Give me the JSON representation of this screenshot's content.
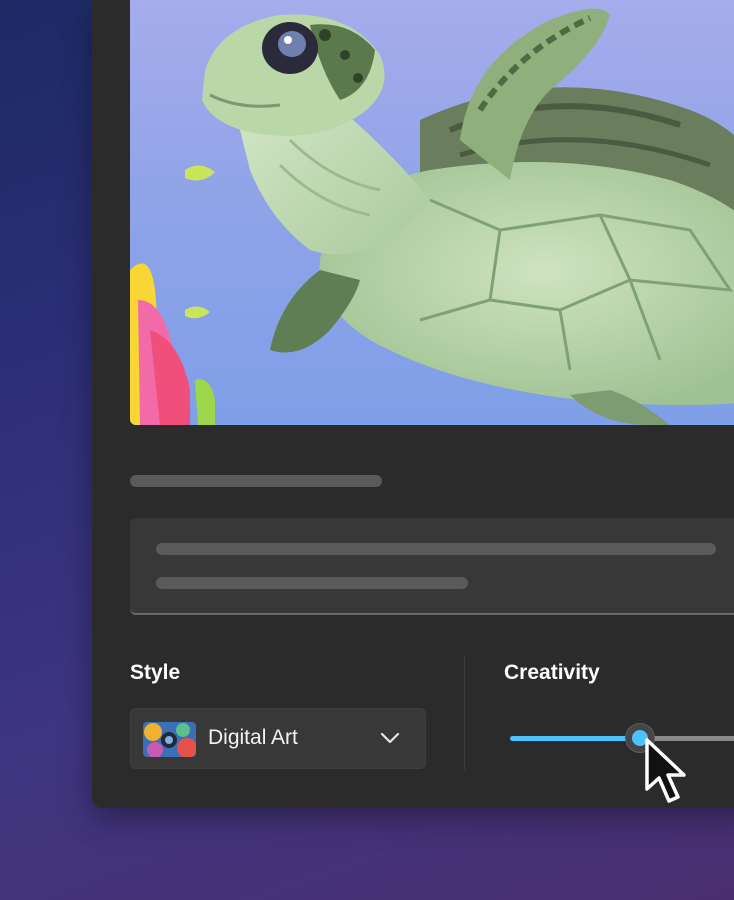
{
  "style": {
    "label": "Style",
    "selected": "Digital Art"
  },
  "creativity": {
    "label": "Creativity",
    "value_fraction": 0.5
  },
  "colors": {
    "accent": "#4cc2ff",
    "panel": "#2b2b2b",
    "field": "#383838"
  },
  "icons": [
    "chevron-down-icon",
    "mouse-cursor-icon"
  ]
}
